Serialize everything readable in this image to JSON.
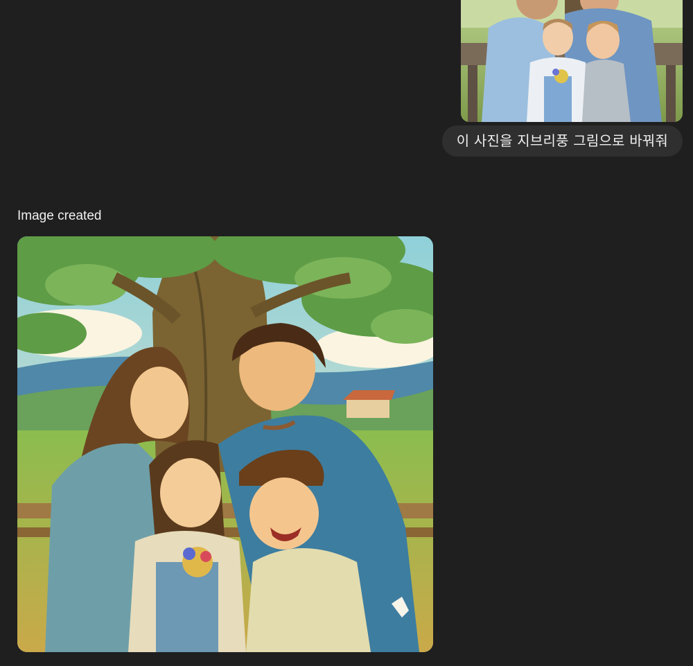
{
  "conversation": {
    "user_message": {
      "text": "이 사진을 지브리풍 그림으로 바꿔줘",
      "attachment_icon": "photo-thumbnail"
    },
    "assistant_message": {
      "status": "Image created",
      "image_icon": "generated-illustration"
    }
  },
  "colors": {
    "background": "#1f1f20",
    "bubble": "#2f2f30",
    "text": "#ececec"
  }
}
